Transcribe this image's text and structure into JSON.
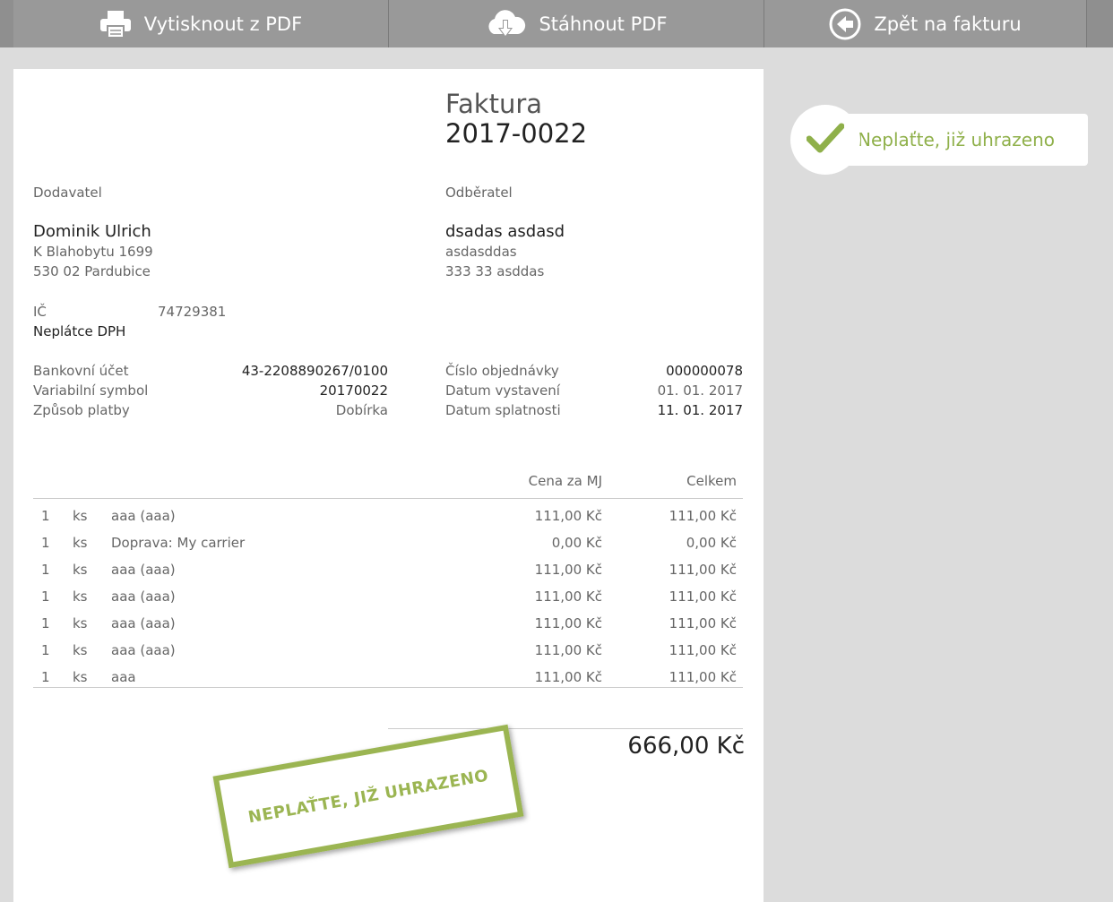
{
  "toolbar": {
    "print_label": "Vytisknout z PDF",
    "download_label": "Stáhnout PDF",
    "back_label": "Zpět na fakturu"
  },
  "invoice": {
    "title": "Faktura",
    "number": "2017-0022",
    "supplier": {
      "heading": "Dodavatel",
      "name": "Dominik Ulrich",
      "street": "K Blahobytu 1699",
      "city": "530 02 Pardubice",
      "ic_label": "IČ",
      "ic_value": "74729381",
      "vat_status": "Neplátce DPH"
    },
    "customer": {
      "heading": "Odběratel",
      "name": "dsadas asdasd",
      "street": "asdasddas",
      "city": "333 33 asddas"
    },
    "payment": {
      "bank_label": "Bankovní účet",
      "bank_value": "43-2208890267/0100",
      "vs_label": "Variabilní symbol",
      "vs_value": "20170022",
      "method_label": "Způsob platby",
      "method_value": "Dobírka"
    },
    "details": {
      "order_label": "Číslo objednávky",
      "order_value": "000000078",
      "issued_label": "Datum vystavení",
      "issued_value": "01. 01. 2017",
      "due_label": "Datum splatnosti",
      "due_value": "11. 01. 2017"
    },
    "table": {
      "unit_price_header": "Cena za MJ",
      "total_header": "Celkem",
      "rows": [
        {
          "qty": "1",
          "unit": "ks",
          "desc": "aaa (aaa)",
          "price": "111,00 Kč",
          "total": "111,00 Kč"
        },
        {
          "qty": "1",
          "unit": "ks",
          "desc": "Doprava: My carrier",
          "price": "0,00 Kč",
          "total": "0,00 Kč"
        },
        {
          "qty": "1",
          "unit": "ks",
          "desc": "aaa (aaa)",
          "price": "111,00 Kč",
          "total": "111,00 Kč"
        },
        {
          "qty": "1",
          "unit": "ks",
          "desc": "aaa (aaa)",
          "price": "111,00 Kč",
          "total": "111,00 Kč"
        },
        {
          "qty": "1",
          "unit": "ks",
          "desc": "aaa (aaa)",
          "price": "111,00 Kč",
          "total": "111,00 Kč"
        },
        {
          "qty": "1",
          "unit": "ks",
          "desc": "aaa (aaa)",
          "price": "111,00 Kč",
          "total": "111,00 Kč"
        },
        {
          "qty": "1",
          "unit": "ks",
          "desc": "aaa",
          "price": "111,00 Kč",
          "total": "111,00 Kč"
        }
      ]
    },
    "grand_total": "666,00 Kč",
    "stamp_text": "NEPLAŤTE, JIŽ UHRAZENO"
  },
  "status": {
    "text": "Neplaťte, již uhrazeno",
    "icon": "checkmark-icon",
    "color": "#8fb04a"
  },
  "colors": {
    "toolbar_bg": "#999999",
    "page_bg": "#dcdcdc",
    "accent_green": "#9bb552"
  }
}
